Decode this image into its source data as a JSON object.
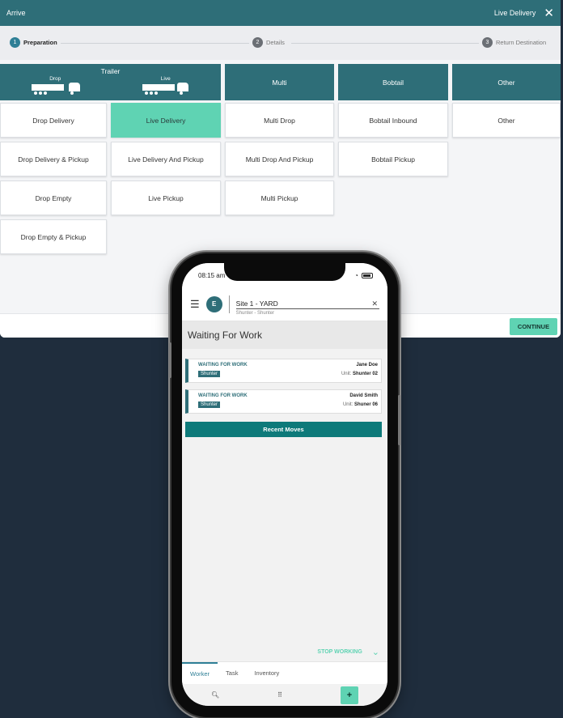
{
  "window": {
    "title": "Arrive",
    "current_type": "Live Delivery",
    "close_icon": "close-icon"
  },
  "stepper": [
    {
      "num": "1",
      "label": "Preparation",
      "active": true
    },
    {
      "num": "2",
      "label": "Details",
      "active": false
    },
    {
      "num": "3",
      "label": "Return Destination",
      "active": false
    }
  ],
  "columns": {
    "trailer": {
      "label": "Trailer",
      "drop": "Drop",
      "live": "Live"
    },
    "multi": "Multi",
    "bobtail": "Bobtail",
    "other": "Other"
  },
  "options": {
    "drop_delivery": "Drop Delivery",
    "live_delivery": "Live Delivery",
    "multi_drop": "Multi Drop",
    "bobtail_inbound": "Bobtail Inbound",
    "other": "Other",
    "drop_delivery_pickup": "Drop Delivery & Pickup",
    "live_delivery_pickup": "Live Delivery And Pickup",
    "multi_drop_pickup": "Multi Drop And Pickup",
    "bobtail_pickup": "Bobtail Pickup",
    "drop_empty": "Drop Empty",
    "live_pickup": "Live Pickup",
    "multi_pickup": "Multi Pickup",
    "drop_empty_pickup": "Drop Empty & Pickup"
  },
  "selected_option": "Live Delivery",
  "continue_label": "CONTINUE",
  "phone": {
    "time": "08:15 am",
    "logo_text": "E",
    "site_name": "Site 1 - YARD",
    "site_sub": "Shunter - Shunter",
    "page_title": "Waiting For Work",
    "cards": [
      {
        "status": "WAITING FOR WORK",
        "badge": "Shunter",
        "name": "Jane Doe",
        "unit_label": "Unit:",
        "unit": "Shunter 02"
      },
      {
        "status": "WAITING FOR WORK",
        "badge": "Shunter",
        "name": "David Smith",
        "unit_label": "Unit:",
        "unit": "Shuner 06"
      }
    ],
    "recent_moves": "Recent Moves",
    "stop_working": "STOP WORKING",
    "tabs": [
      "Worker",
      "Task",
      "Inventory"
    ],
    "active_tab": "Worker",
    "nav": {
      "search": "search-icon",
      "grid": "grid-icon",
      "add": "plus-icon"
    }
  },
  "colors": {
    "teal": "#2e6e78",
    "mint": "#5fd3b3",
    "background": "#1f2d3d"
  }
}
